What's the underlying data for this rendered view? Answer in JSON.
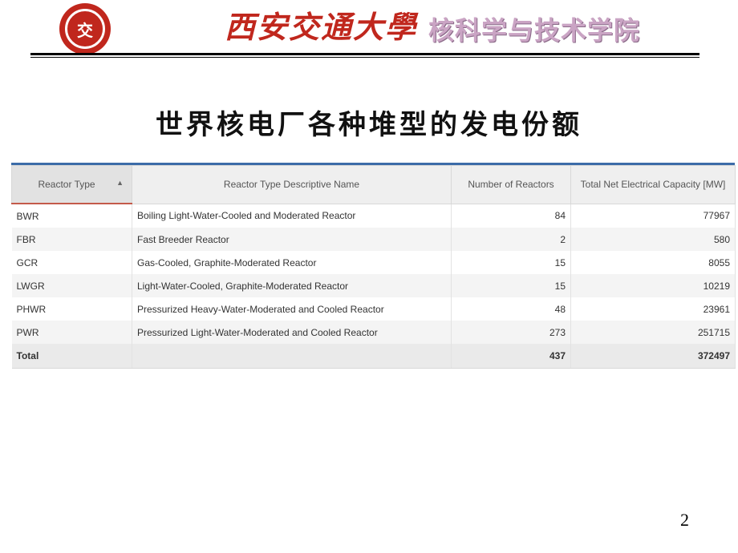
{
  "header": {
    "logo_text": "交",
    "university": "西安交通大學",
    "school": "核科学与技术学院"
  },
  "title": "世界核电厂各种堆型的发电份额",
  "table": {
    "columns": [
      "Reactor Type",
      "Reactor Type Descriptive Name",
      "Number of Reactors",
      "Total Net Electrical Capacity [MW]"
    ],
    "sort_indicator": "▲",
    "rows": [
      {
        "type": "BWR",
        "name": "Boiling Light-Water-Cooled and Moderated Reactor",
        "count": "84",
        "capacity": "77967"
      },
      {
        "type": "FBR",
        "name": "Fast Breeder Reactor",
        "count": "2",
        "capacity": "580"
      },
      {
        "type": "GCR",
        "name": "Gas-Cooled, Graphite-Moderated Reactor",
        "count": "15",
        "capacity": "8055"
      },
      {
        "type": "LWGR",
        "name": "Light-Water-Cooled, Graphite-Moderated Reactor",
        "count": "15",
        "capacity": "10219"
      },
      {
        "type": "PHWR",
        "name": "Pressurized Heavy-Water-Moderated and Cooled Reactor",
        "count": "48",
        "capacity": "23961"
      },
      {
        "type": "PWR",
        "name": "Pressurized Light-Water-Moderated and Cooled Reactor",
        "count": "273",
        "capacity": "251715"
      }
    ],
    "total": {
      "label": "Total",
      "name": "",
      "count": "437",
      "capacity": "372497"
    }
  },
  "page_number": "2",
  "colors": {
    "brand_red": "#c0271d",
    "table_accent": "#3c6ca8",
    "school_title": "#caa4c4"
  }
}
